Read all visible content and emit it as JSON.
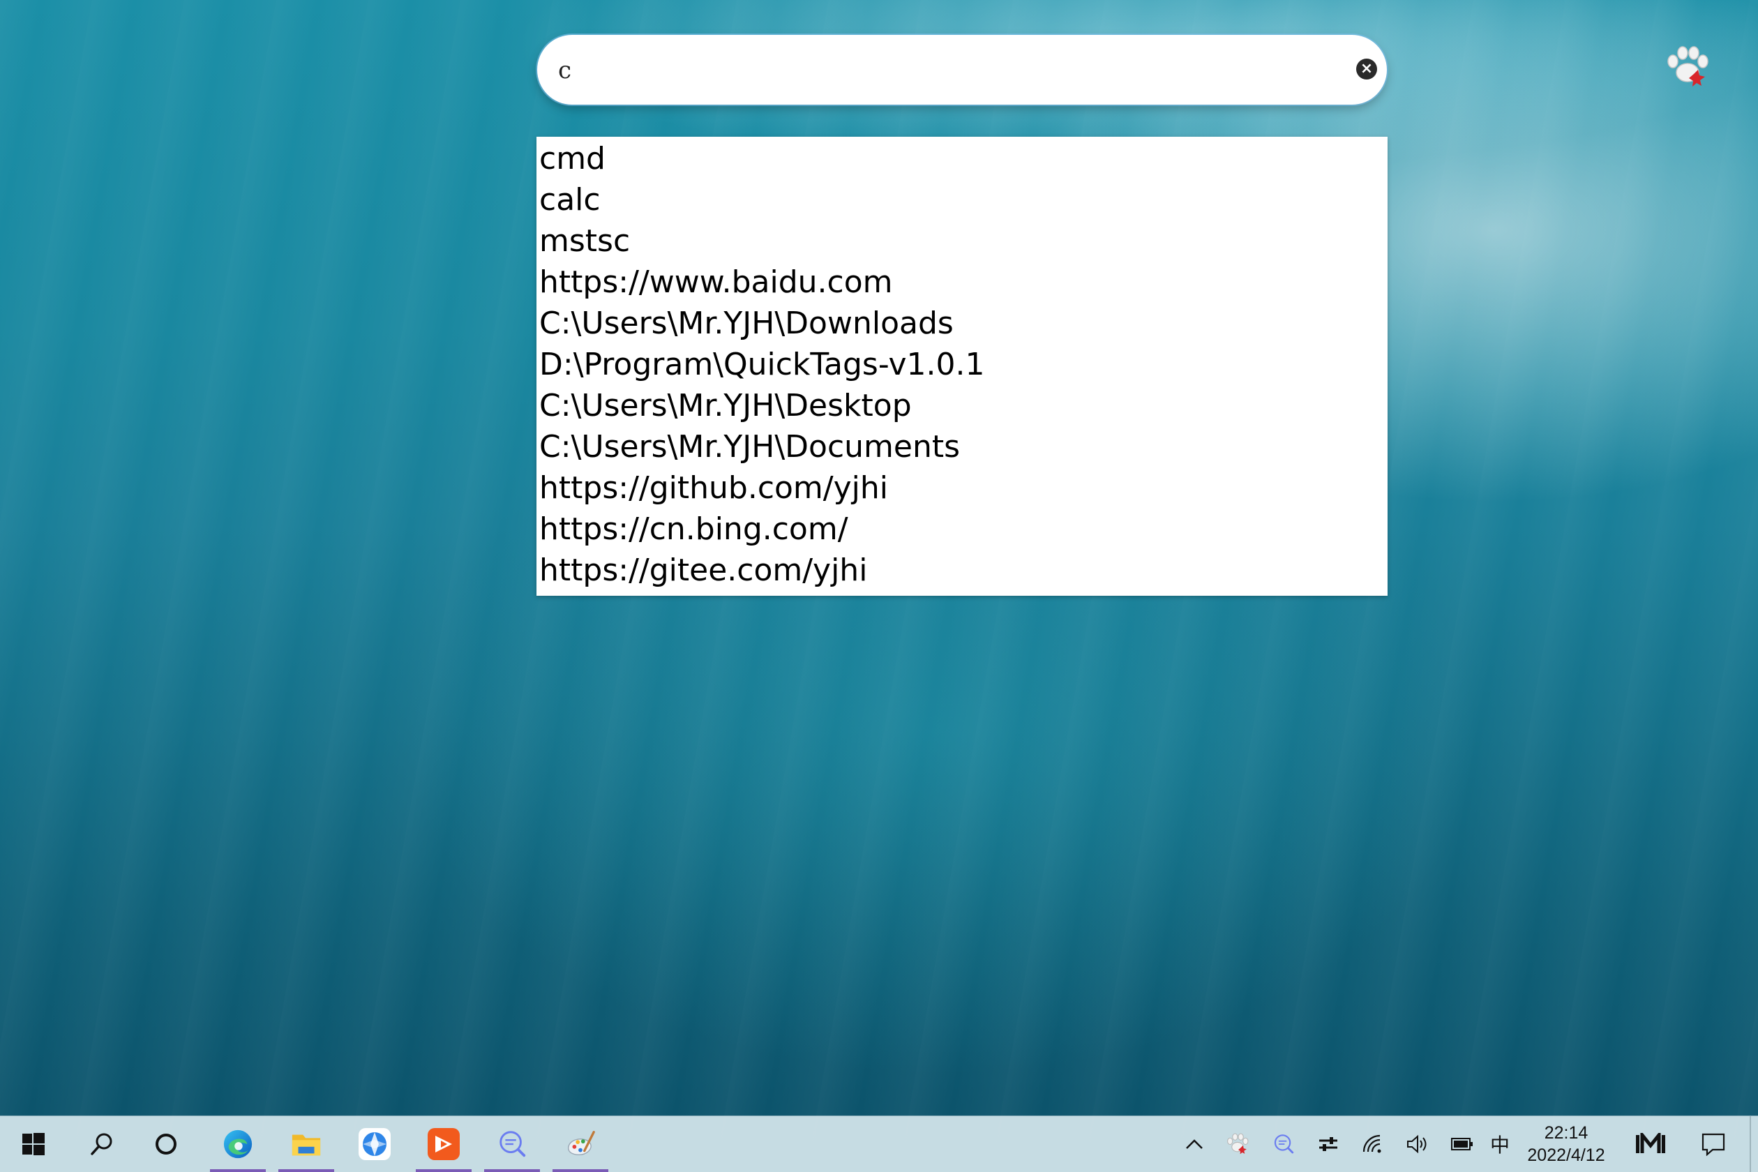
{
  "search": {
    "value": "c",
    "placeholder": ""
  },
  "results": [
    "cmd",
    "calc",
    "mstsc",
    "https://www.baidu.com",
    "C:\\Users\\Mr.YJH\\Downloads",
    "D:\\Program\\QuickTags-v1.0.1",
    "C:\\Users\\Mr.YJH\\Desktop",
    "C:\\Users\\Mr.YJH\\Documents",
    "https://github.com/yjhi",
    "https://cn.bing.com/",
    "https://gitee.com/yjhi"
  ],
  "taskbar": {
    "apps": [
      {
        "icon": "edge-icon",
        "active": true
      },
      {
        "icon": "file-explorer-icon",
        "active": true
      },
      {
        "icon": "browser-icon",
        "active": false
      },
      {
        "icon": "video-player-icon",
        "active": true
      },
      {
        "icon": "search-app-icon",
        "active": true
      },
      {
        "icon": "paint-icon",
        "active": true
      }
    ],
    "tray": {
      "ime": "中",
      "time": "22:14",
      "date": "2022/4/12"
    }
  },
  "colors": {
    "taskbar_underline": "#7a5bb6",
    "search_border": "#78bee9"
  }
}
